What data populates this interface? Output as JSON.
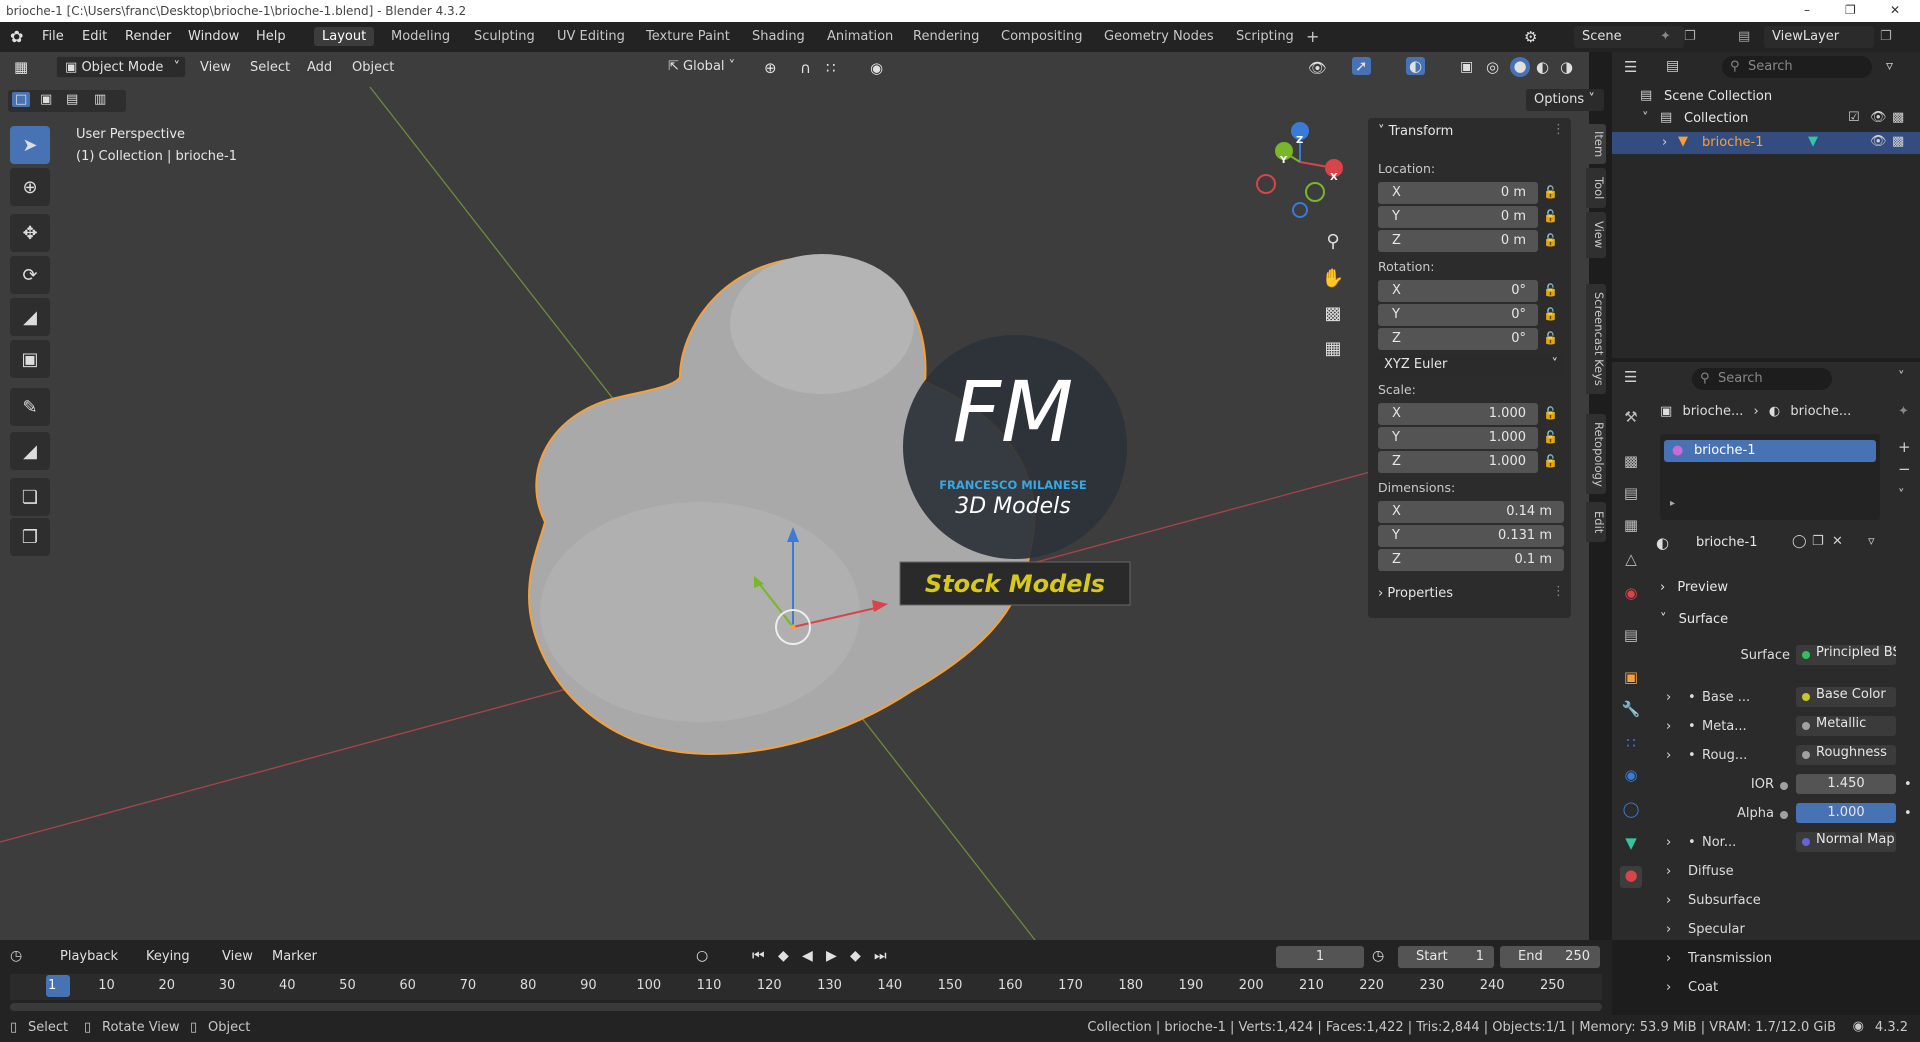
{
  "window": {
    "title": "brioche-1 [C:\\Users\\franc\\Desktop\\brioche-1\\brioche-1.blend] - Blender 4.3.2",
    "min": "–",
    "max": "❐",
    "close": "✕"
  },
  "menu": [
    "File",
    "Edit",
    "Render",
    "Window",
    "Help"
  ],
  "workspaces": [
    "Layout",
    "Modeling",
    "Sculpting",
    "UV Editing",
    "Texture Paint",
    "Shading",
    "Animation",
    "Rendering",
    "Compositing",
    "Geometry Nodes",
    "Scripting"
  ],
  "scene": "Scene",
  "view_layer": "ViewLayer",
  "viewport_header": {
    "mode": "Object Mode",
    "view": "View",
    "select": "Select",
    "add": "Add",
    "object": "Object",
    "orientation": "Global",
    "options": "Options"
  },
  "viewport_info": {
    "perspective": "User Perspective",
    "collection": "(1) Collection | brioche-1"
  },
  "watermark": {
    "logo": "FM",
    "name": "FRANCESCO MILANESE",
    "sub": "3D Models",
    "banner": "Stock Models"
  },
  "gizmo": {
    "x": "X",
    "y": "Y",
    "z": "Z"
  },
  "npanel": {
    "section": "Transform",
    "location_label": "Location:",
    "location": [
      {
        "ax": "X",
        "v": "0 m"
      },
      {
        "ax": "Y",
        "v": "0 m"
      },
      {
        "ax": "Z",
        "v": "0 m"
      }
    ],
    "rotation_label": "Rotation:",
    "rotation": [
      {
        "ax": "X",
        "v": "0°"
      },
      {
        "ax": "Y",
        "v": "0°"
      },
      {
        "ax": "Z",
        "v": "0°"
      }
    ],
    "euler": "XYZ Euler",
    "scale_label": "Scale:",
    "scale": [
      {
        "ax": "X",
        "v": "1.000"
      },
      {
        "ax": "Y",
        "v": "1.000"
      },
      {
        "ax": "Z",
        "v": "1.000"
      }
    ],
    "dimensions_label": "Dimensions:",
    "dimensions": [
      {
        "ax": "X",
        "v": "0.14 m"
      },
      {
        "ax": "Y",
        "v": "0.131 m"
      },
      {
        "ax": "Z",
        "v": "0.1 m"
      }
    ],
    "properties": "Properties"
  },
  "side_tabs": [
    "Item",
    "Tool",
    "View",
    "Screencast Keys",
    "Retopology",
    "Edit"
  ],
  "outliner": {
    "search": "Search",
    "scene_collection": "Scene Collection",
    "collection": "Collection",
    "object": "brioche-1"
  },
  "properties": {
    "search": "Search",
    "breadcrumb_obj": "brioche...",
    "breadcrumb_mat": "brioche...",
    "slot": "brioche-1",
    "material": "brioche-1",
    "preview": "Preview",
    "surface_section": "Surface",
    "rows": [
      {
        "label": "Surface",
        "value": "Principled BS...",
        "color": "#33c05a"
      },
      {
        "label": "Base ...",
        "value": "Base Color",
        "color": "#c8c82a"
      },
      {
        "label": "Meta...",
        "value": "Metallic",
        "color": "#a0a0a0"
      },
      {
        "label": "Roug...",
        "value": "Roughness",
        "color": "#a0a0a0"
      },
      {
        "label": "IOR",
        "value": "1.450",
        "color": "#a0a0a0"
      },
      {
        "label": "Alpha",
        "value": "1.000",
        "color": "#a0a0a0"
      },
      {
        "label": "Nor...",
        "value": "Normal Map",
        "color": "#6464d8"
      }
    ],
    "collapsed": [
      "Diffuse",
      "Subsurface",
      "Specular",
      "Transmission",
      "Coat"
    ]
  },
  "timeline": {
    "playback": "Playback",
    "keying": "Keying",
    "view": "View",
    "marker": "Marker",
    "current": "1",
    "start_label": "Start",
    "start": "1",
    "end_label": "End",
    "end": "250",
    "ticks": [
      "1",
      "10",
      "20",
      "30",
      "40",
      "50",
      "60",
      "70",
      "80",
      "90",
      "100",
      "110",
      "120",
      "130",
      "140",
      "150",
      "160",
      "170",
      "180",
      "190",
      "200",
      "210",
      "220",
      "230",
      "240",
      "250"
    ]
  },
  "status": {
    "select": "Select",
    "rotate": "Rotate View",
    "object": "Object",
    "stats": "Collection | brioche-1 | Verts:1,424 | Faces:1,422 | Tris:2,844 | Objects:1/1 | Memory: 53.9 MiB | VRAM: 1.7/12.0 GiB",
    "version": "4.3.2"
  },
  "colors": {
    "accent": "#4772b3",
    "selection": "#f5a03a",
    "x_axis": "#d9434a",
    "y_axis": "#7ab62a",
    "z_axis": "#3a7bd5"
  }
}
